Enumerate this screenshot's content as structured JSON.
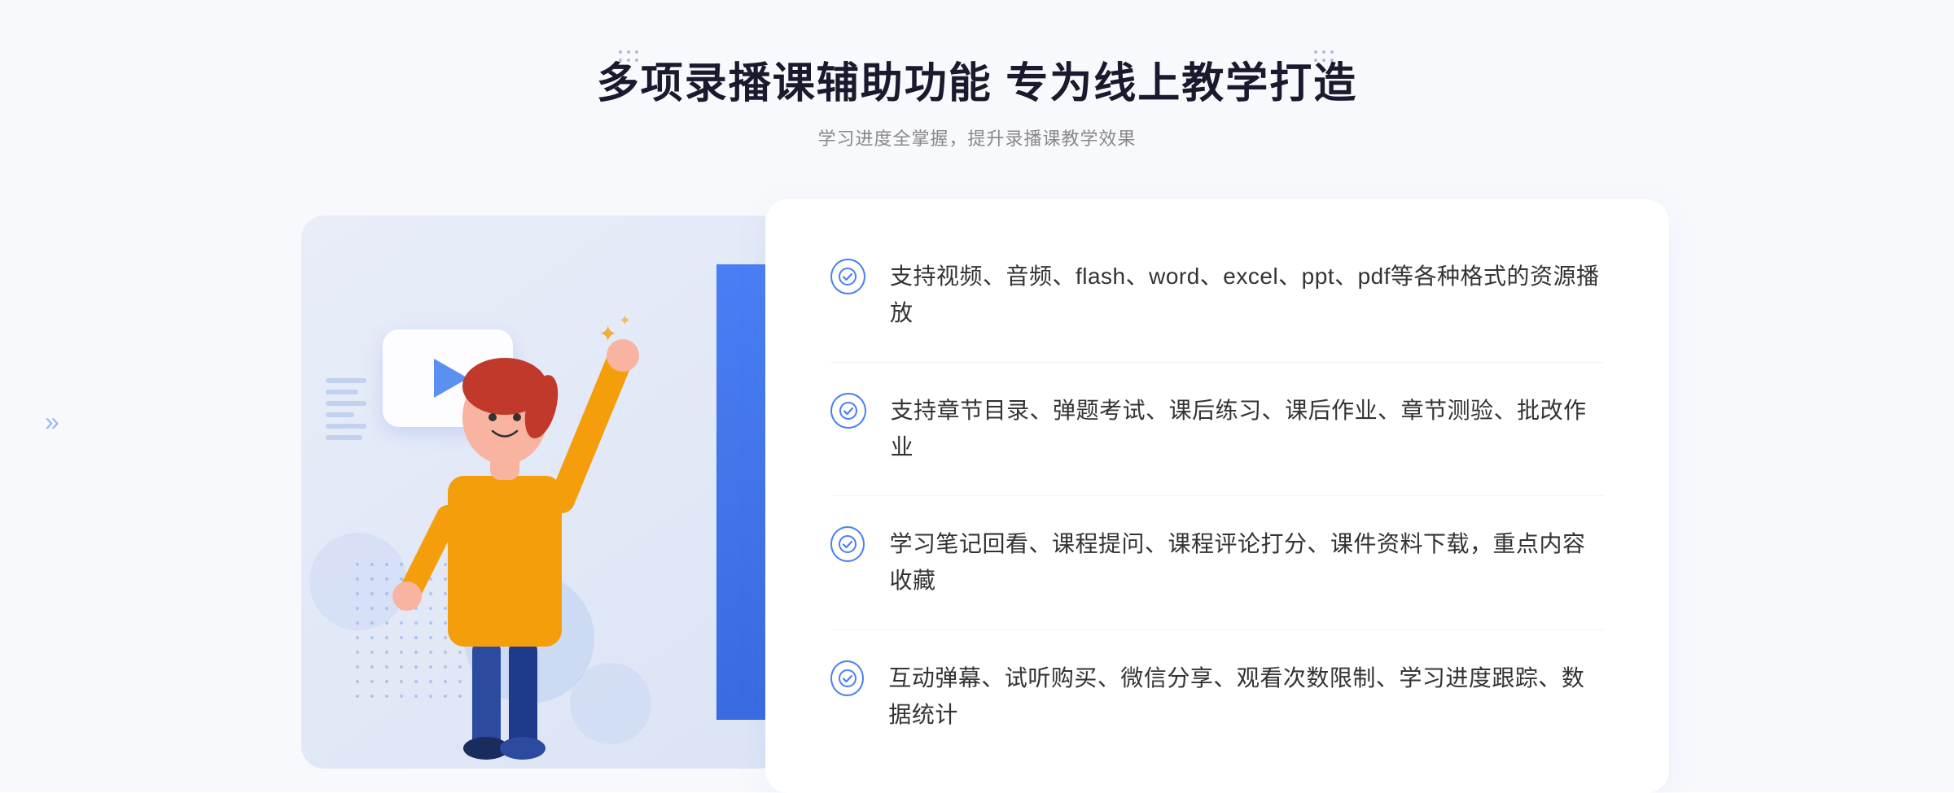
{
  "page": {
    "background_color": "#f8f9fc"
  },
  "header": {
    "main_title": "多项录播课辅助功能 专为线上教学打造",
    "sub_title": "学习进度全掌握，提升录播课教学效果"
  },
  "features": [
    {
      "id": "feature-1",
      "text": "支持视频、音频、flash、word、excel、ppt、pdf等各种格式的资源播放"
    },
    {
      "id": "feature-2",
      "text": "支持章节目录、弹题考试、课后练习、课后作业、章节测验、批改作业"
    },
    {
      "id": "feature-3",
      "text": "学习笔记回看、课程提问、课程评论打分、课件资料下载，重点内容收藏"
    },
    {
      "id": "feature-4",
      "text": "互动弹幕、试听购买、微信分享、观看次数限制、学习进度跟踪、数据统计"
    }
  ],
  "decorations": {
    "check_symbol": "✓",
    "arrow_symbol": "»",
    "play_label": "play"
  },
  "colors": {
    "primary_blue": "#4a7ef5",
    "title_color": "#1a1a2e",
    "text_color": "#333333",
    "subtitle_color": "#888888",
    "bg_color": "#f8f9fc"
  }
}
